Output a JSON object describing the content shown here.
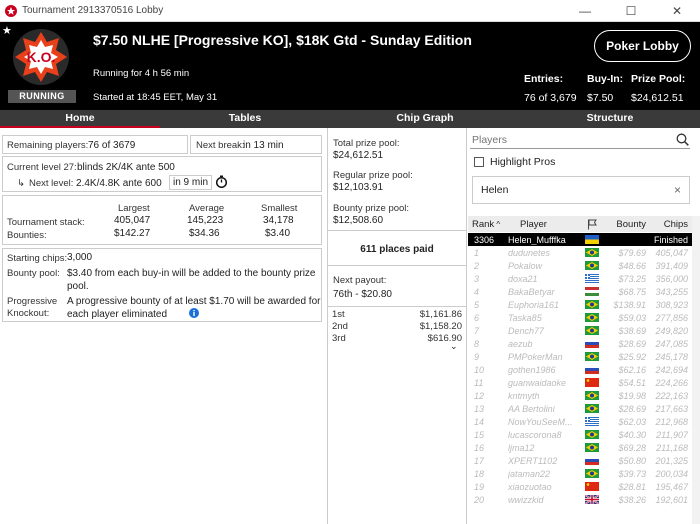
{
  "window": {
    "title": "Tournament 2913370516 Lobby",
    "minimize": "—",
    "maximize": "☐",
    "close": "✕"
  },
  "header": {
    "logo_text": "K.O.",
    "status_badge": "RUNNING",
    "tournament_name": "$7.50 NLHE [Progressive KO], $18K Gtd - Sunday Edition",
    "running_for": "Running for 4 h 56 min",
    "started_at": "Started at 18:45 EET, May 31",
    "lobby_button": "Poker Lobby",
    "entries_label": "Entries:",
    "entries_value": "76 of 3,679",
    "buyin_label": "Buy-In:",
    "buyin_value": "$7.50",
    "prizepool_label": "Prize Pool:",
    "prizepool_value": "$24,612.51"
  },
  "tabs": [
    "Home",
    "Tables",
    "Chip Graph",
    "Structure"
  ],
  "home": {
    "remaining_label": "Remaining players:",
    "remaining_value": "76 of 3679",
    "next_break_label": "Next break:",
    "next_break_value": "in 13 min",
    "current_level_label": "Current level 27:",
    "current_level_value": "blinds 2K/4K ante 500",
    "next_level_label": "Next level:",
    "next_level_value": "2.4K/4.8K ante 600",
    "next_level_time": "in 9 min",
    "stats_headers": [
      "Largest",
      "Average",
      "Smallest"
    ],
    "stack_label": "Tournament stack:",
    "stack_values": [
      "405,047",
      "145,223",
      "34,178"
    ],
    "bounties_label": "Bounties:",
    "bounty_values": [
      "$142.27",
      "$34.36",
      "$3.40"
    ],
    "starting_chips_label": "Starting chips:",
    "starting_chips_value": "3,000",
    "bounty_pool_label": "Bounty pool:",
    "bounty_pool_text": "$3.40 from each buy-in will be added to the bounty prize pool.",
    "progressive_label_1": "Progressive",
    "progressive_label_2": "Knockout:",
    "progressive_text": "A progressive bounty of at least $1.70 will be awarded for each player eliminated"
  },
  "prizes": {
    "total_label": "Total prize pool:",
    "total_value": "$24,612.51",
    "regular_label": "Regular prize pool:",
    "regular_value": "$12,103.91",
    "bounty_label": "Bounty prize pool:",
    "bounty_value": "$12,508.60",
    "places_paid": "611 places paid",
    "next_payout_label": "Next payout:",
    "next_payout_value": "76th - $20.80",
    "payouts": [
      {
        "place": "1st",
        "amount": "$1,161.86"
      },
      {
        "place": "2nd",
        "amount": "$1,158.20"
      },
      {
        "place": "3rd",
        "amount": "$616.90"
      }
    ]
  },
  "players_panel": {
    "search_placeholder": "Players",
    "highlight_label": "Highlight Pros",
    "filter_value": "Helen",
    "clear": "×",
    "columns": [
      "Rank",
      "Player",
      "Bounty",
      "Chips"
    ],
    "rows": [
      {
        "rank": "3306",
        "player": "Helen_Mufffka",
        "flag": "ua",
        "bounty": "",
        "chips": "Finished",
        "selected": true
      },
      {
        "rank": "1",
        "player": "dudunetes",
        "flag": "br",
        "bounty": "$79.69",
        "chips": "405,047"
      },
      {
        "rank": "2",
        "player": "Pokalow",
        "flag": "br",
        "bounty": "$48.66",
        "chips": "391,409"
      },
      {
        "rank": "3",
        "player": "doxa21",
        "flag": "gr",
        "bounty": "$73.25",
        "chips": "356,000"
      },
      {
        "rank": "4",
        "player": "BakaBetyar",
        "flag": "hu",
        "bounty": "$68.75",
        "chips": "343,255"
      },
      {
        "rank": "5",
        "player": "Euphoria161",
        "flag": "br",
        "bounty": "$138.91",
        "chips": "308,923"
      },
      {
        "rank": "6",
        "player": "Taska85",
        "flag": "br",
        "bounty": "$59.03",
        "chips": "277,856"
      },
      {
        "rank": "7",
        "player": "Dench77",
        "flag": "br",
        "bounty": "$38.69",
        "chips": "249,820"
      },
      {
        "rank": "8",
        "player": "aezub",
        "flag": "ru",
        "bounty": "$28.69",
        "chips": "247,085"
      },
      {
        "rank": "9",
        "player": "PMPokerMan",
        "flag": "br",
        "bounty": "$25.92",
        "chips": "245,178"
      },
      {
        "rank": "10",
        "player": "gothen1986",
        "flag": "ru",
        "bounty": "$62.16",
        "chips": "242,694"
      },
      {
        "rank": "11",
        "player": "guanwaidaoke",
        "flag": "cn",
        "bounty": "$54.51",
        "chips": "224,266"
      },
      {
        "rank": "12",
        "player": "kntmyth",
        "flag": "br",
        "bounty": "$19.98",
        "chips": "222,163"
      },
      {
        "rank": "13",
        "player": "AA Bertolini",
        "flag": "br",
        "bounty": "$28.69",
        "chips": "217,663"
      },
      {
        "rank": "14",
        "player": "NowYouSeeM...",
        "flag": "gr",
        "bounty": "$62.03",
        "chips": "212,968"
      },
      {
        "rank": "15",
        "player": "lucascorona8",
        "flag": "br",
        "bounty": "$40.30",
        "chips": "211,907"
      },
      {
        "rank": "16",
        "player": "ljma12",
        "flag": "br",
        "bounty": "$69.28",
        "chips": "211,168"
      },
      {
        "rank": "17",
        "player": "XPERT1102",
        "flag": "ru",
        "bounty": "$50.80",
        "chips": "201,325"
      },
      {
        "rank": "18",
        "player": "jataman22",
        "flag": "br",
        "bounty": "$39.73",
        "chips": "200,034"
      },
      {
        "rank": "19",
        "player": "xiaozuotao",
        "flag": "cn",
        "bounty": "$28.81",
        "chips": "195,467"
      },
      {
        "rank": "20",
        "player": "wwizzkid",
        "flag": "gb",
        "bounty": "$38.26",
        "chips": "192,601"
      }
    ]
  },
  "colors": {
    "accent_red": "#c8001e",
    "header_bg": "#000000",
    "tabs_bg": "#3a3a3a",
    "selected_row_bg": "#000000"
  }
}
